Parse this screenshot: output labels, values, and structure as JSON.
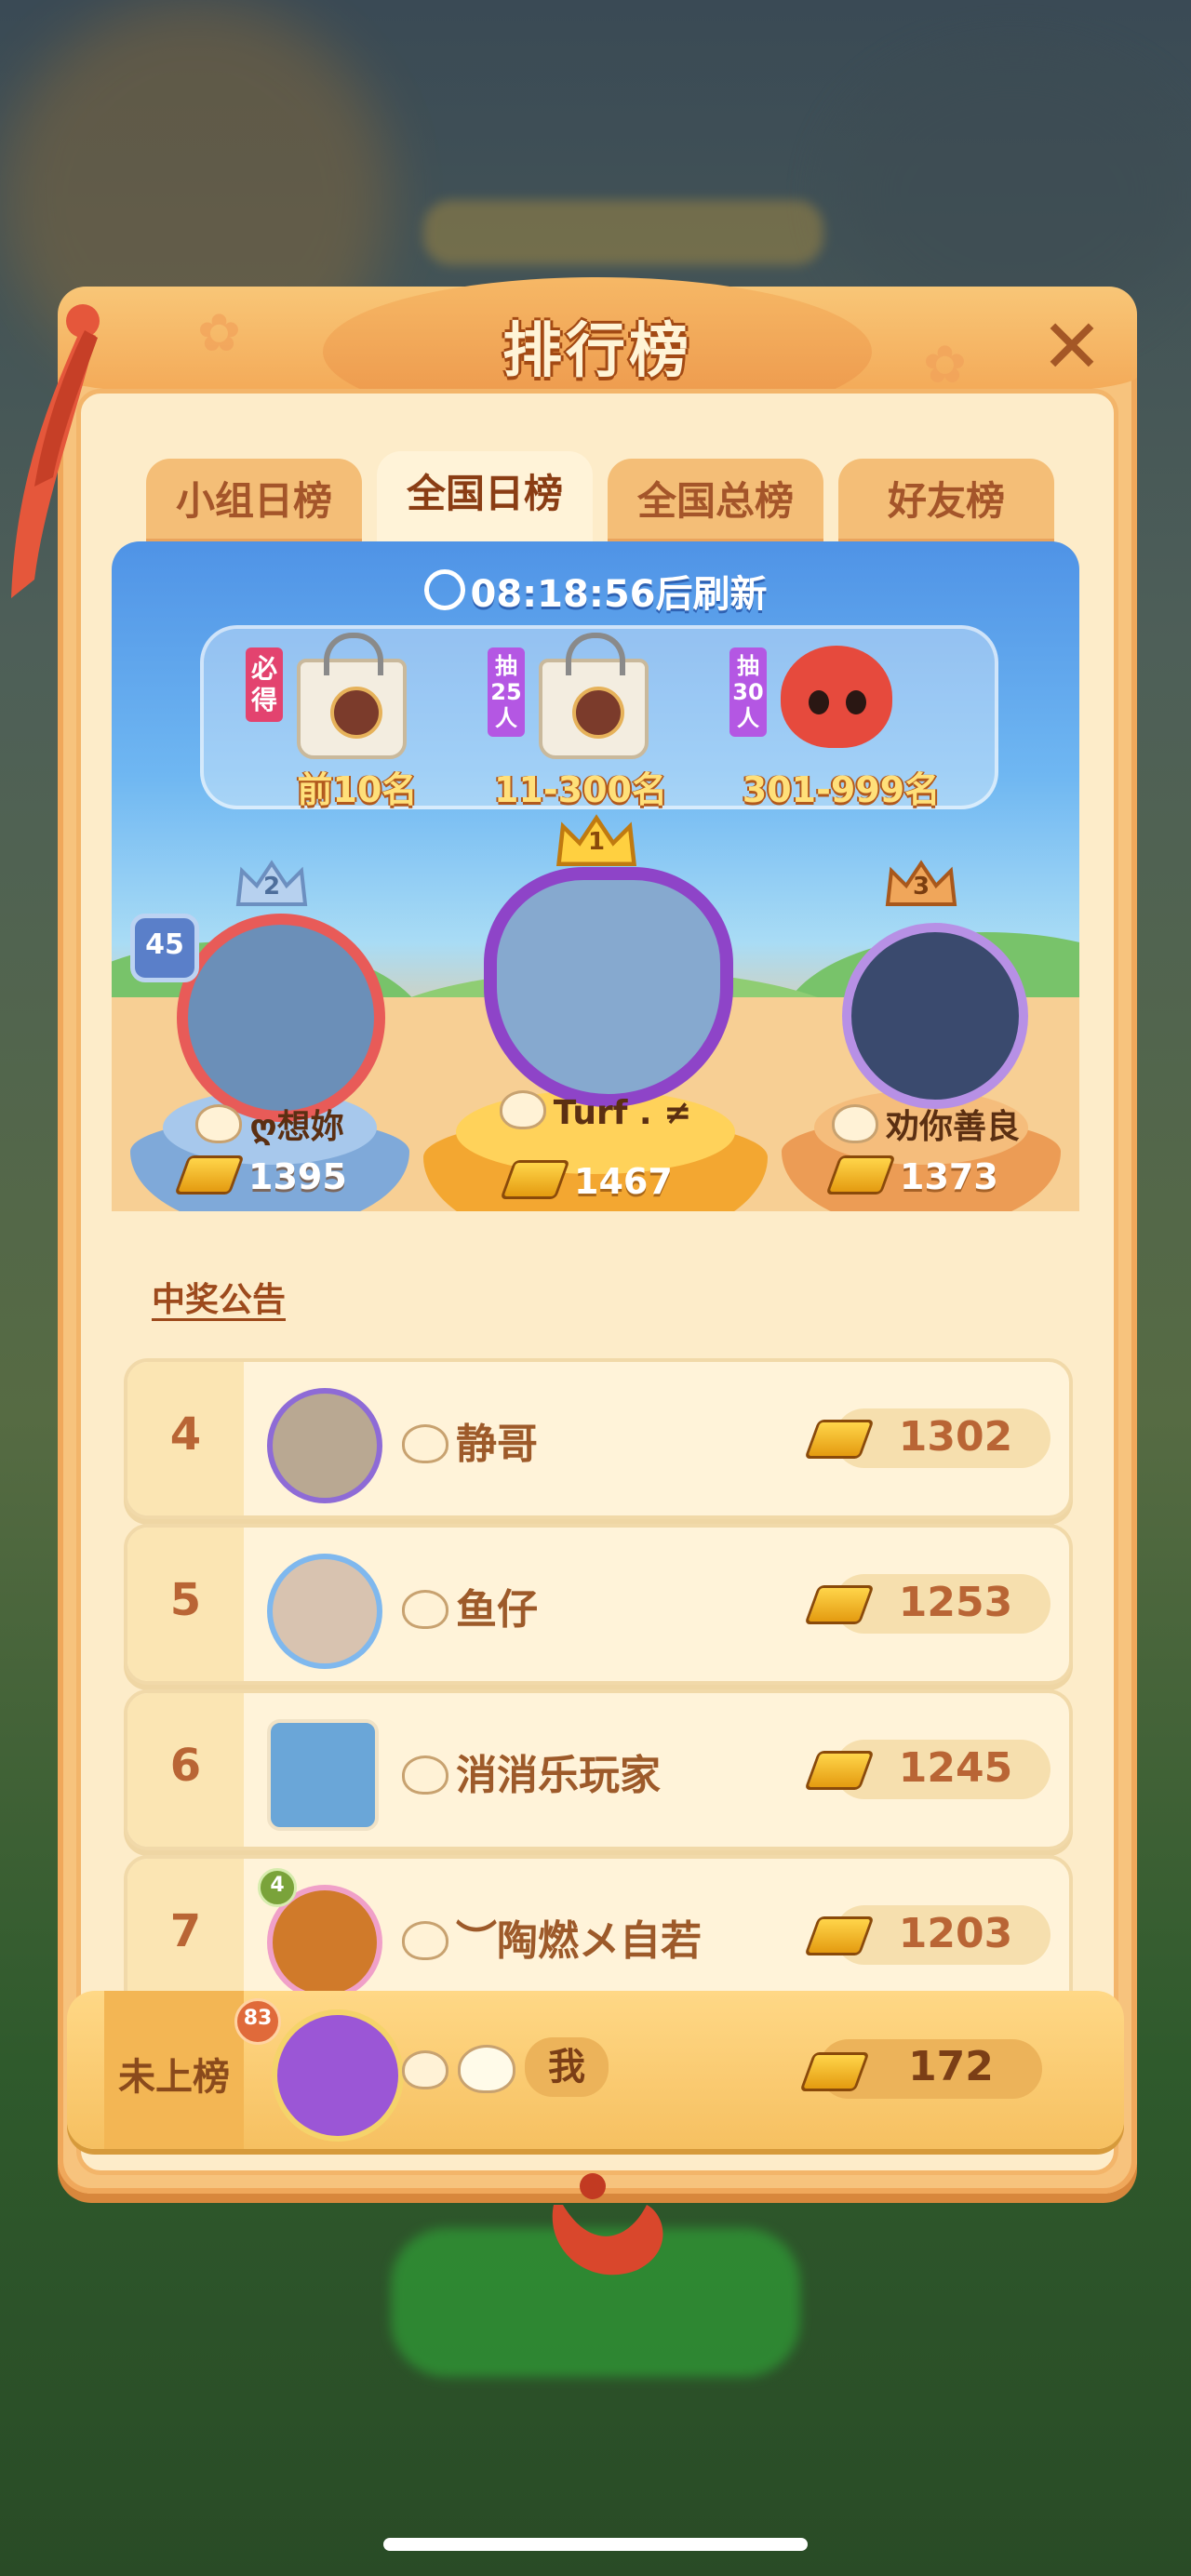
{
  "panel": {
    "title": "排行榜",
    "close_icon": "close-icon"
  },
  "tabs": [
    {
      "label": "小组日榜",
      "active": false
    },
    {
      "label": "全国日榜",
      "active": true
    },
    {
      "label": "全国总榜",
      "active": false
    },
    {
      "label": "好友榜",
      "active": false
    }
  ],
  "timer": {
    "text": "08:18:56后刷新"
  },
  "rewards": [
    {
      "tag": "必得",
      "label": "前10名",
      "prize_icon": "gift-bag-icon"
    },
    {
      "tag": "抽25人",
      "label": "11-300名",
      "prize_icon": "gift-bag-icon"
    },
    {
      "tag": "抽30人",
      "label": "301-999名",
      "prize_icon": "fox-plush-icon"
    }
  ],
  "podium": {
    "first": {
      "rank": "1",
      "name": "Turf . ≠",
      "score": "1467"
    },
    "second": {
      "rank": "2",
      "name": "ღ想妳",
      "score": "1395",
      "level": "45"
    },
    "third": {
      "rank": "3",
      "name": "劝你善良",
      "score": "1373"
    }
  },
  "notice_link": "中奖公告",
  "list": [
    {
      "rank": "4",
      "name": "静哥",
      "score": "1302"
    },
    {
      "rank": "5",
      "name": "鱼仔",
      "score": "1253"
    },
    {
      "rank": "6",
      "name": "消消乐玩家",
      "score": "1245"
    },
    {
      "rank": "7",
      "name": "︶陶燃メ自若",
      "score": "1203",
      "level": "4"
    }
  ],
  "me": {
    "rank": "未上榜",
    "name": "我",
    "score": "172",
    "level": "83"
  },
  "colors": {
    "panel": "#f7c37d",
    "accent": "#b96535",
    "sky": "#4f93e6"
  }
}
